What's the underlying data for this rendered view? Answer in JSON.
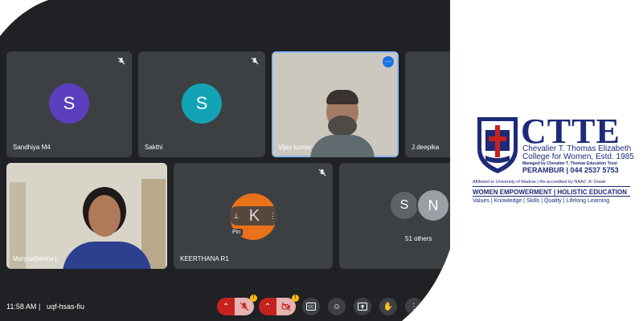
{
  "participants": [
    {
      "name": "Sandhiya M4",
      "initial": "S",
      "color": "#5b3fbf"
    },
    {
      "name": "Sakthi",
      "initial": "S",
      "color": "#12a4b4"
    },
    {
      "name": "Vijay kumar"
    },
    {
      "name": "J.deepika"
    },
    {
      "name": "Marycatherine j"
    },
    {
      "name": "KEERTHANA R1",
      "initial": "K",
      "color": "#e8711a"
    },
    {
      "name": "51 others",
      "initials": [
        "S",
        "N"
      ]
    }
  ],
  "pin_label": "Pin",
  "bottom_bar": {
    "time": "11:58 AM",
    "separator": "|",
    "meeting_code": "uqf-hsas-fiu",
    "warning_badge": "!"
  },
  "colors": {
    "background": "#202124",
    "tile": "#3c4043",
    "mic_off_red": "#c5221f",
    "selected_outline": "#8ab4f8",
    "brand_navy": "#1e2a78"
  },
  "logo": {
    "acronym": "CTTE",
    "line1": "Chevalier T. Thomas Elizabeth",
    "line2": "College for Women, Estd. 1985",
    "managed": "Managed by Chevalier T. Thomas Education Trust",
    "location": "PERAMBUR | 044 2537 5753",
    "affiliation": "Affiliated to University of Madras | Re-accredited by NAAC 'A' Grade",
    "tagline": "WOMEN EMPOWERMENT | HOLISTIC EDUCATION",
    "values": "Values | Knowledge | Skills | Quality | Lifelong Learning"
  }
}
